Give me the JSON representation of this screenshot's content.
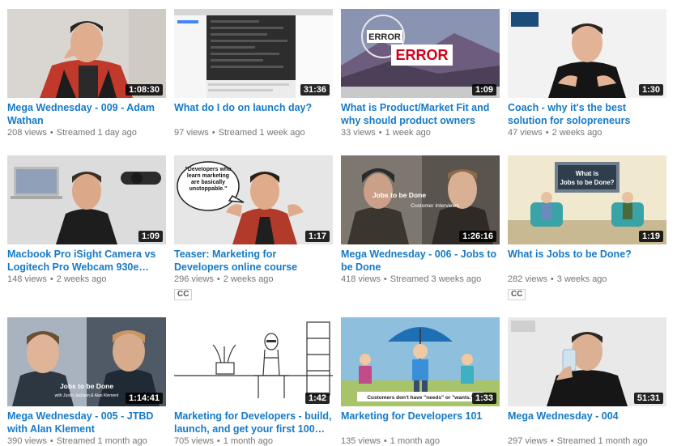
{
  "videos": [
    {
      "title": "Mega Wednesday - 009 - Adam Wathan",
      "views": "208 views",
      "age": "Streamed 1 day ago",
      "duration": "1:08:30",
      "cc": ""
    },
    {
      "title": "What do I do on launch day?",
      "views": "97 views",
      "age": "Streamed 1 week ago",
      "duration": "31:36",
      "cc": ""
    },
    {
      "title": "What is Product/Market Fit and why should product owners care?",
      "views": "33 views",
      "age": "1 week ago",
      "duration": "1:09",
      "cc": ""
    },
    {
      "title": "Coach - why it's the best solution for solopreneurs",
      "views": "47 views",
      "age": "2 weeks ago",
      "duration": "1:30",
      "cc": ""
    },
    {
      "title": "Macbook Pro iSight Camera vs Logitech Pro Webcam 930e…",
      "views": "148 views",
      "age": "2 weeks ago",
      "duration": "1:09",
      "cc": ""
    },
    {
      "title": "Teaser: Marketing for Developers online course",
      "views": "296 views",
      "age": "2 weeks ago",
      "duration": "1:17",
      "cc": "CC"
    },
    {
      "title": "Mega Wednesday - 006 - Jobs to be Done",
      "views": "418 views",
      "age": "Streamed 3 weeks ago",
      "duration": "1:26:16",
      "cc": ""
    },
    {
      "title": "What is Jobs to be Done?",
      "views": "282 views",
      "age": "3 weeks ago",
      "duration": "1:19",
      "cc": "CC"
    },
    {
      "title": "Mega Wednesday - 005 - JTBD with Alan Klement",
      "views": "390 views",
      "age": "Streamed 1 month ago",
      "duration": "1:14:41",
      "cc": ""
    },
    {
      "title": "Marketing for Developers - build, launch, and get your first 100…",
      "views": "705 views",
      "age": "1 month ago",
      "duration": "1:42",
      "cc": ""
    },
    {
      "title": "Marketing for Developers 101",
      "views": "135 views",
      "age": "1 month ago",
      "duration": "1:33",
      "cc": ""
    },
    {
      "title": "Mega Wednesday - 004",
      "views": "297 views",
      "age": "Streamed 1 month ago",
      "duration": "51:31",
      "cc": ""
    }
  ],
  "thumb_text": {
    "error_small": "ERROR",
    "error_big": "ERROR",
    "bubble": "\"Developers who learn marketing are basically unstoppable.\"",
    "jtbd_question": "What is Jobs to be Done?",
    "jtbd_label": "Jobs to be Done",
    "jtbd_sub": "Customer Interviews",
    "jtbd_guest": "Jobs to be Done",
    "jtbd_guest_sub": "with Justin Jackson & Alan Klement",
    "customers": "Customers don't have \"needs\" or \"wants.\""
  }
}
